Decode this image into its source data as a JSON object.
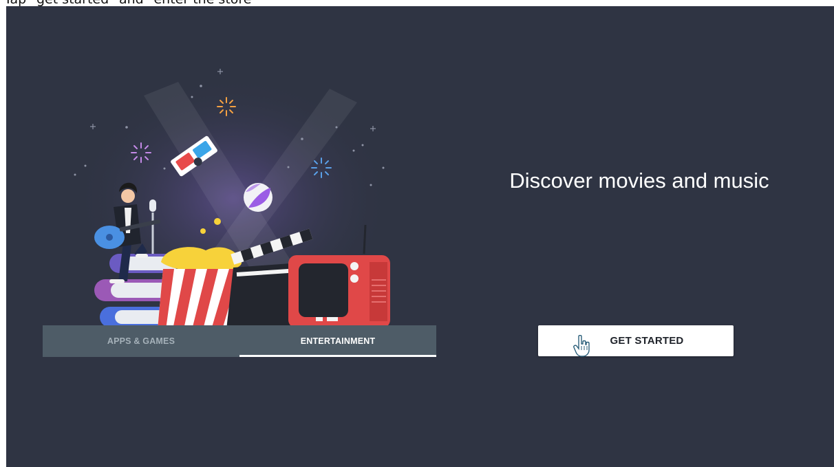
{
  "instruction": "Tap \"get started\" and \"enter the store\"",
  "tabs": [
    {
      "label": "APPS & GAMES",
      "active": false
    },
    {
      "label": "ENTERTAINMENT",
      "active": true
    }
  ],
  "headline": "Discover movies and music",
  "cta": {
    "label": "GET STARTED"
  },
  "colors": {
    "background": "#2f3443",
    "tabbar": "#4e5c67",
    "button": "#ffffff"
  }
}
